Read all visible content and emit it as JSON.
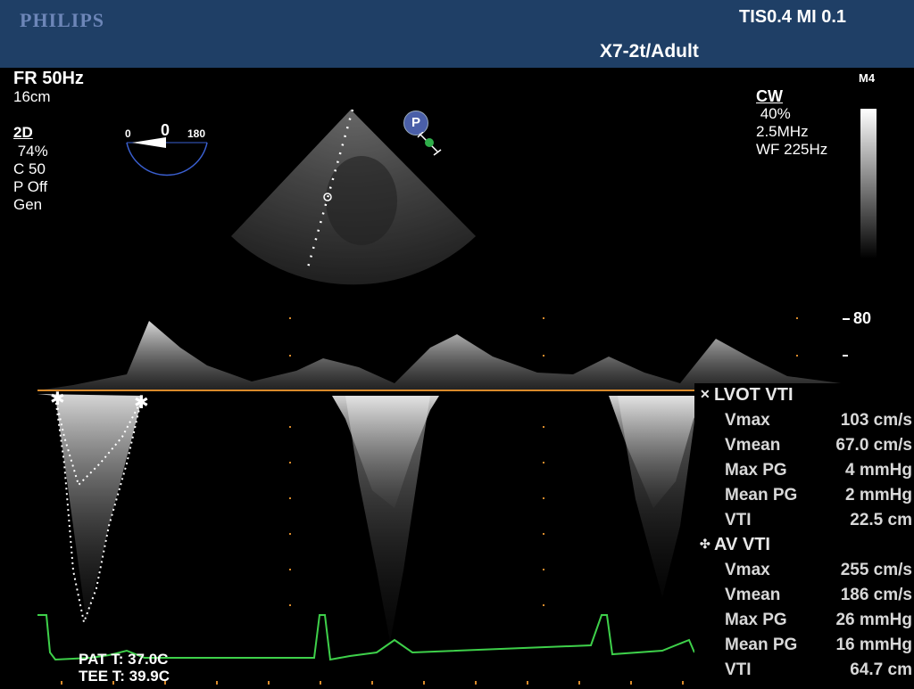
{
  "header": {
    "brand": "PHILIPS",
    "tis_mi": "TIS0.4   MI 0.1",
    "probe": "X7-2t/Adult"
  },
  "left_params": {
    "frame_rate": "FR 50Hz",
    "depth": "16cm",
    "mode": "2D",
    "gain": " 74%",
    "compression": "C 50",
    "persistence": "P Off",
    "general": "Gen"
  },
  "probe_angle": {
    "min": "0",
    "value": "0",
    "max": "180"
  },
  "doppler_params": {
    "mode": "CW",
    "gain": " 40%",
    "frequency": "2.5MHz",
    "wall_filter": "WF 225Hz",
    "map": "M4"
  },
  "sector_marker": "P",
  "scale": {
    "top_label": "80"
  },
  "measurements": [
    {
      "title": "LVOT VTI",
      "symbol": "✕",
      "rows": [
        {
          "label": "Vmax",
          "value": "103 cm/s"
        },
        {
          "label": "Vmean",
          "value": "67.0 cm/s"
        },
        {
          "label": "Max PG",
          "value": "4 mmHg"
        },
        {
          "label": "Mean PG",
          "value": "2 mmHg"
        },
        {
          "label": "VTI",
          "value": "22.5 cm"
        }
      ]
    },
    {
      "title": "AV VTI",
      "symbol": "✣",
      "rows": [
        {
          "label": "Vmax",
          "value": "255 cm/s"
        },
        {
          "label": "Vmean",
          "value": "186 cm/s"
        },
        {
          "label": "Max PG",
          "value": "26 mmHg"
        },
        {
          "label": "Mean PG",
          "value": "16 mmHg"
        },
        {
          "label": "VTI",
          "value": "64.7 cm"
        }
      ]
    }
  ],
  "temperatures": {
    "patient": "PAT T: 37.0C",
    "tee": "TEE T: 39.9C"
  },
  "colors": {
    "header_bg": "#1f3f66",
    "baseline": "#d98a2b",
    "ecg": "#3ed04a",
    "angle_arc": "#3a5fd0"
  }
}
